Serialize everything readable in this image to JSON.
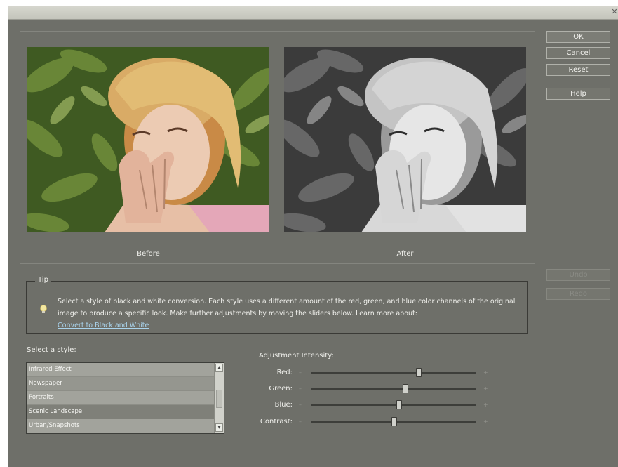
{
  "window": {
    "close_glyph": "✕"
  },
  "preview": {
    "before_caption": "Before",
    "after_caption": "After"
  },
  "buttons": {
    "ok": "OK",
    "cancel": "Cancel",
    "reset": "Reset",
    "help": "Help",
    "undo": "Undo",
    "redo": "Redo"
  },
  "tip": {
    "legend": "Tip",
    "text": "Select a style of black and white conversion. Each style uses a different amount of the red, green, and blue color channels of the original image to produce a specific look. Make further adjustments by moving the sliders below. Learn more about:",
    "link": "Convert to Black and White"
  },
  "style_section": {
    "label": "Select a style:",
    "items": [
      "Infrared Effect",
      "Newspaper",
      "Portraits",
      "Scenic Landscape",
      "Urban/Snapshots"
    ],
    "selected": "Scenic Landscape"
  },
  "adjustment": {
    "label": "Adjustment Intensity:",
    "sliders": [
      {
        "name": "Red:",
        "value": 0.65
      },
      {
        "name": "Green:",
        "value": 0.57
      },
      {
        "name": "Blue:",
        "value": 0.53
      },
      {
        "name": "Contrast:",
        "value": 0.5
      }
    ],
    "minus_glyph": "–",
    "plus_glyph": "+"
  },
  "colors": {
    "dialog_bg": "#6e6f69",
    "link": "#a9d3ec"
  }
}
